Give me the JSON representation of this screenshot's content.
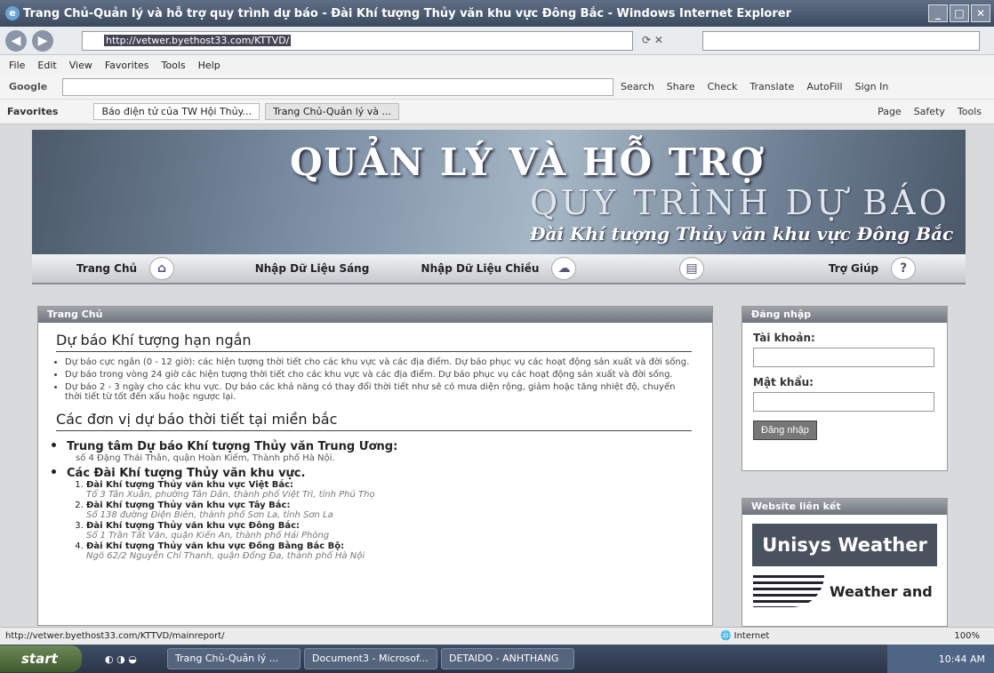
{
  "window": {
    "title": "Trang Chủ-Quản lý và hỗ trợ quy trình dự báo - Đài Khí tượng Thủy văn khu vực Đông Bắc - Windows Internet Explorer",
    "url": "http://vetwer.byethost33.com/KTTVD/"
  },
  "menu": [
    "File",
    "Edit",
    "View",
    "Favorites",
    "Tools",
    "Help"
  ],
  "google_toolbar": {
    "brand": "Google",
    "items": [
      "Search",
      "Share",
      "Check",
      "Translate",
      "AutoFill",
      "Sign In"
    ]
  },
  "favorites": {
    "label": "Favorites",
    "tab1": "Báo điện tử của TW Hội Thủy...",
    "tab2": "Trang Chủ-Quản lý và ...",
    "commands": [
      "Page",
      "Safety",
      "Tools"
    ]
  },
  "banner": {
    "line1": "QUẢN LÝ VÀ HỖ TRỢ",
    "line2": "QUY TRÌNH DỰ BÁO",
    "line3": "Đài Khí tượng Thủy văn khu vực Đông Bắc"
  },
  "nav": [
    {
      "label": "Trang Chủ"
    },
    {
      "label": "Nhập Dữ Liệu Sáng"
    },
    {
      "label": "Nhập Dữ Liệu Chiều"
    },
    {
      "label": ""
    },
    {
      "label": "Trợ Giúp"
    }
  ],
  "main": {
    "header": "Trang Chủ",
    "section1_title": "Dự báo Khí tượng hạn ngắn",
    "bullets": [
      "Dự báo cực ngắn (0 - 12 giờ): các hiện tượng thời tiết cho các khu vực và các địa điểm. Dự báo phục vụ các hoạt động sản xuất và đời sống.",
      "Dự báo trong vòng 24 giờ các hiện tượng thời tiết cho các khu vực và các địa điểm. Dự báo phục vụ các hoạt động sản xuất và đời sống.",
      "Dự báo 2 - 3 ngày cho các khu vực. Dự báo các khả năng có thay đổi thời tiết như sẽ có mưa diện rộng, giảm hoặc tăng nhiệt độ, chuyển thời tiết từ tốt đến xấu hoặc ngược lại."
    ],
    "section2_title": "Các đơn vị dự báo thời tiết tại miền bắc",
    "unit1_name": "Trung tâm Dự báo Khí tượng Thủy văn Trung Ương:",
    "unit1_addr": "số 4 Đặng Thái Thân, quận Hoàn Kiếm, Thành phố Hà Nội.",
    "unit2_name": "Các Đài Khí tượng Thủy văn khu vực.",
    "stations": [
      {
        "name": "Đài Khí tượng Thủy văn khu vực Việt Bắc:",
        "addr": "Tổ 3 Tân Xuân, phường Tân Dân, thành phố Việt Trì, tỉnh Phú Thọ"
      },
      {
        "name": "Đài Khí tượng Thủy văn khu vực Tây Bắc:",
        "addr": "Số 138 đường Điện Biên, thành phố Sơn La, tỉnh Sơn La"
      },
      {
        "name": "Đài Khí tượng Thủy văn khu vực Đông Bắc:",
        "addr": "Số 1 Trần Tất Văn, quận Kiến An, thành phố Hải Phòng"
      },
      {
        "name": "Đài Khí tượng Thủy văn khu vực Đồng Bằng Bắc Bộ:",
        "addr": "Ngõ 62/2 Nguyễn Chí Thanh, quận Đống Đa, thành phố Hà Nội"
      }
    ]
  },
  "login": {
    "header": "Đăng nhập",
    "account_label": "Tài khoản:",
    "password_label": "Mật khẩu:",
    "button": "Đăng nhập"
  },
  "links": {
    "header": "Website liên kết",
    "unisys": "Unisys Weather",
    "weather2": "Weather and"
  },
  "status": {
    "url": "http://vetwer.byethost33.com/KTTVD/mainreport/",
    "zone": "Internet",
    "zoom": "100%"
  },
  "taskbar": {
    "start": "start",
    "tasks": [
      "Trang Chủ-Quản lý ...",
      "Document3 - Microsof...",
      "DETAIDO - ANHTHANG"
    ],
    "clock": "10:44 AM"
  }
}
